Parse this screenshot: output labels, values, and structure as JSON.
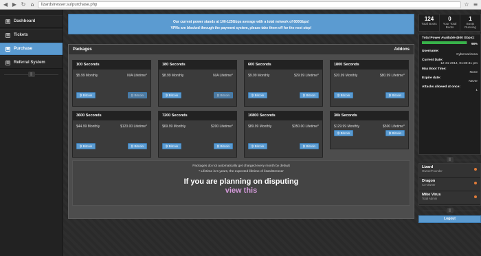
{
  "browser": {
    "url": "lizardstresser.su/purchase.php"
  },
  "sidebar": {
    "items": [
      {
        "label": "Dashboard",
        "icon": "dashboard-icon"
      },
      {
        "label": "Tickets",
        "icon": "ticket-icon"
      },
      {
        "label": "Purchase",
        "icon": "cart-icon",
        "active": true
      },
      {
        "label": "Referral System",
        "icon": "referral-icon"
      }
    ]
  },
  "notice": {
    "line1": "Our current power stands at 100-125Gbps average with a total network of 600Gbps!",
    "line2": "VPNs are blocked through the payment system, please take them off for the next step!"
  },
  "packages": {
    "title": "Packages",
    "addons": "Addons",
    "cards": [
      {
        "name": "100 Seconds",
        "monthly": "$5.99 Monthly",
        "lifetime": "N/A Lifetime*",
        "btn_monthly": "₿ Bitcoin",
        "btn_lifetime": "₿ Bitcoin",
        "lifetime_disabled": true
      },
      {
        "name": "180 Seconds",
        "monthly": "$8.99 Monthly",
        "lifetime": "N/A Lifetime*",
        "btn_monthly": "₿ Bitcoin",
        "btn_lifetime": "₿ Bitcoin",
        "lifetime_disabled": true
      },
      {
        "name": "600 Seconds",
        "monthly": "$9.99 Monthly",
        "lifetime": "$29.99 Lifetime*",
        "btn_monthly": "₿ Bitcoin",
        "btn_lifetime": "₿ Bitcoin",
        "lifetime_disabled": false
      },
      {
        "name": "1800 Seconds",
        "monthly": "$20.99 Monthly",
        "lifetime": "$80.99 Lifetime*",
        "btn_monthly": "₿ Bitcoin",
        "btn_lifetime": "₿ Bitcoin",
        "lifetime_disabled": false
      },
      {
        "name": "3600 Seconds",
        "monthly": "$44.99 Monthly",
        "lifetime": "$120.00 Lifetime*",
        "btn_monthly": "₿ Bitcoin",
        "btn_lifetime": "₿ Bitcoin",
        "lifetime_disabled": false
      },
      {
        "name": "7200 Seconds",
        "monthly": "$69.99 Monthly",
        "lifetime": "$200 Lifetime*",
        "btn_monthly": "₿ Bitcoin",
        "btn_lifetime": "₿ Bitcoin",
        "lifetime_disabled": false
      },
      {
        "name": "10800 Seconds",
        "monthly": "$89.99 Monthly",
        "lifetime": "$350.00 Lifetime*",
        "btn_monthly": "₿ Bitcoin",
        "btn_lifetime": "₿ Bitcoin",
        "lifetime_disabled": false
      },
      {
        "name": "30k Seconds",
        "monthly": "$129.99 Monthly",
        "lifetime": "$500 Lifetime*",
        "btn_monthly": "₿ Bitcoin",
        "btn_lifetime": "₿ Bitcoin",
        "lifetime_disabled": false
      }
    ],
    "info_line1": "Packages do not automatically get charged every month by default",
    "info_line2": "* Lifetime is 5 years, the expected lifetime of lizardstresser",
    "dispute_text": "If you are planning on disputing",
    "dispute_link": "view this"
  },
  "stats": [
    {
      "value": "124",
      "label": "Total Boots"
    },
    {
      "value": "0",
      "label": "Your Total Boots"
    },
    {
      "value": "1",
      "label": "Boots Running"
    }
  ],
  "account": {
    "power_label": "Total Power Available (600 Gbps):",
    "power_percent": "98%",
    "power_fraction": 0.98,
    "username_label": "Username:",
    "username": "Cybervarizona",
    "date_label": "Current Date:",
    "date": "12-31-2014, 01:30:41 pm",
    "max_boot_label": "Max Boot Time:",
    "max_boot": "None",
    "expire_label": "Expire date:",
    "expire": "Never",
    "attacks_label": "Attacks allowed at once:",
    "attacks": "1"
  },
  "users": [
    {
      "name": "Lizard",
      "role": "Owner/Founder"
    },
    {
      "name": "Dragon",
      "role": "Co-Owner"
    },
    {
      "name": "Mike Virus",
      "role": "Total Admin"
    }
  ],
  "logout": "Logout",
  "colors": {
    "accent": "#5b9bd1",
    "progress": "#38b24a",
    "link": "#d39ad9"
  }
}
